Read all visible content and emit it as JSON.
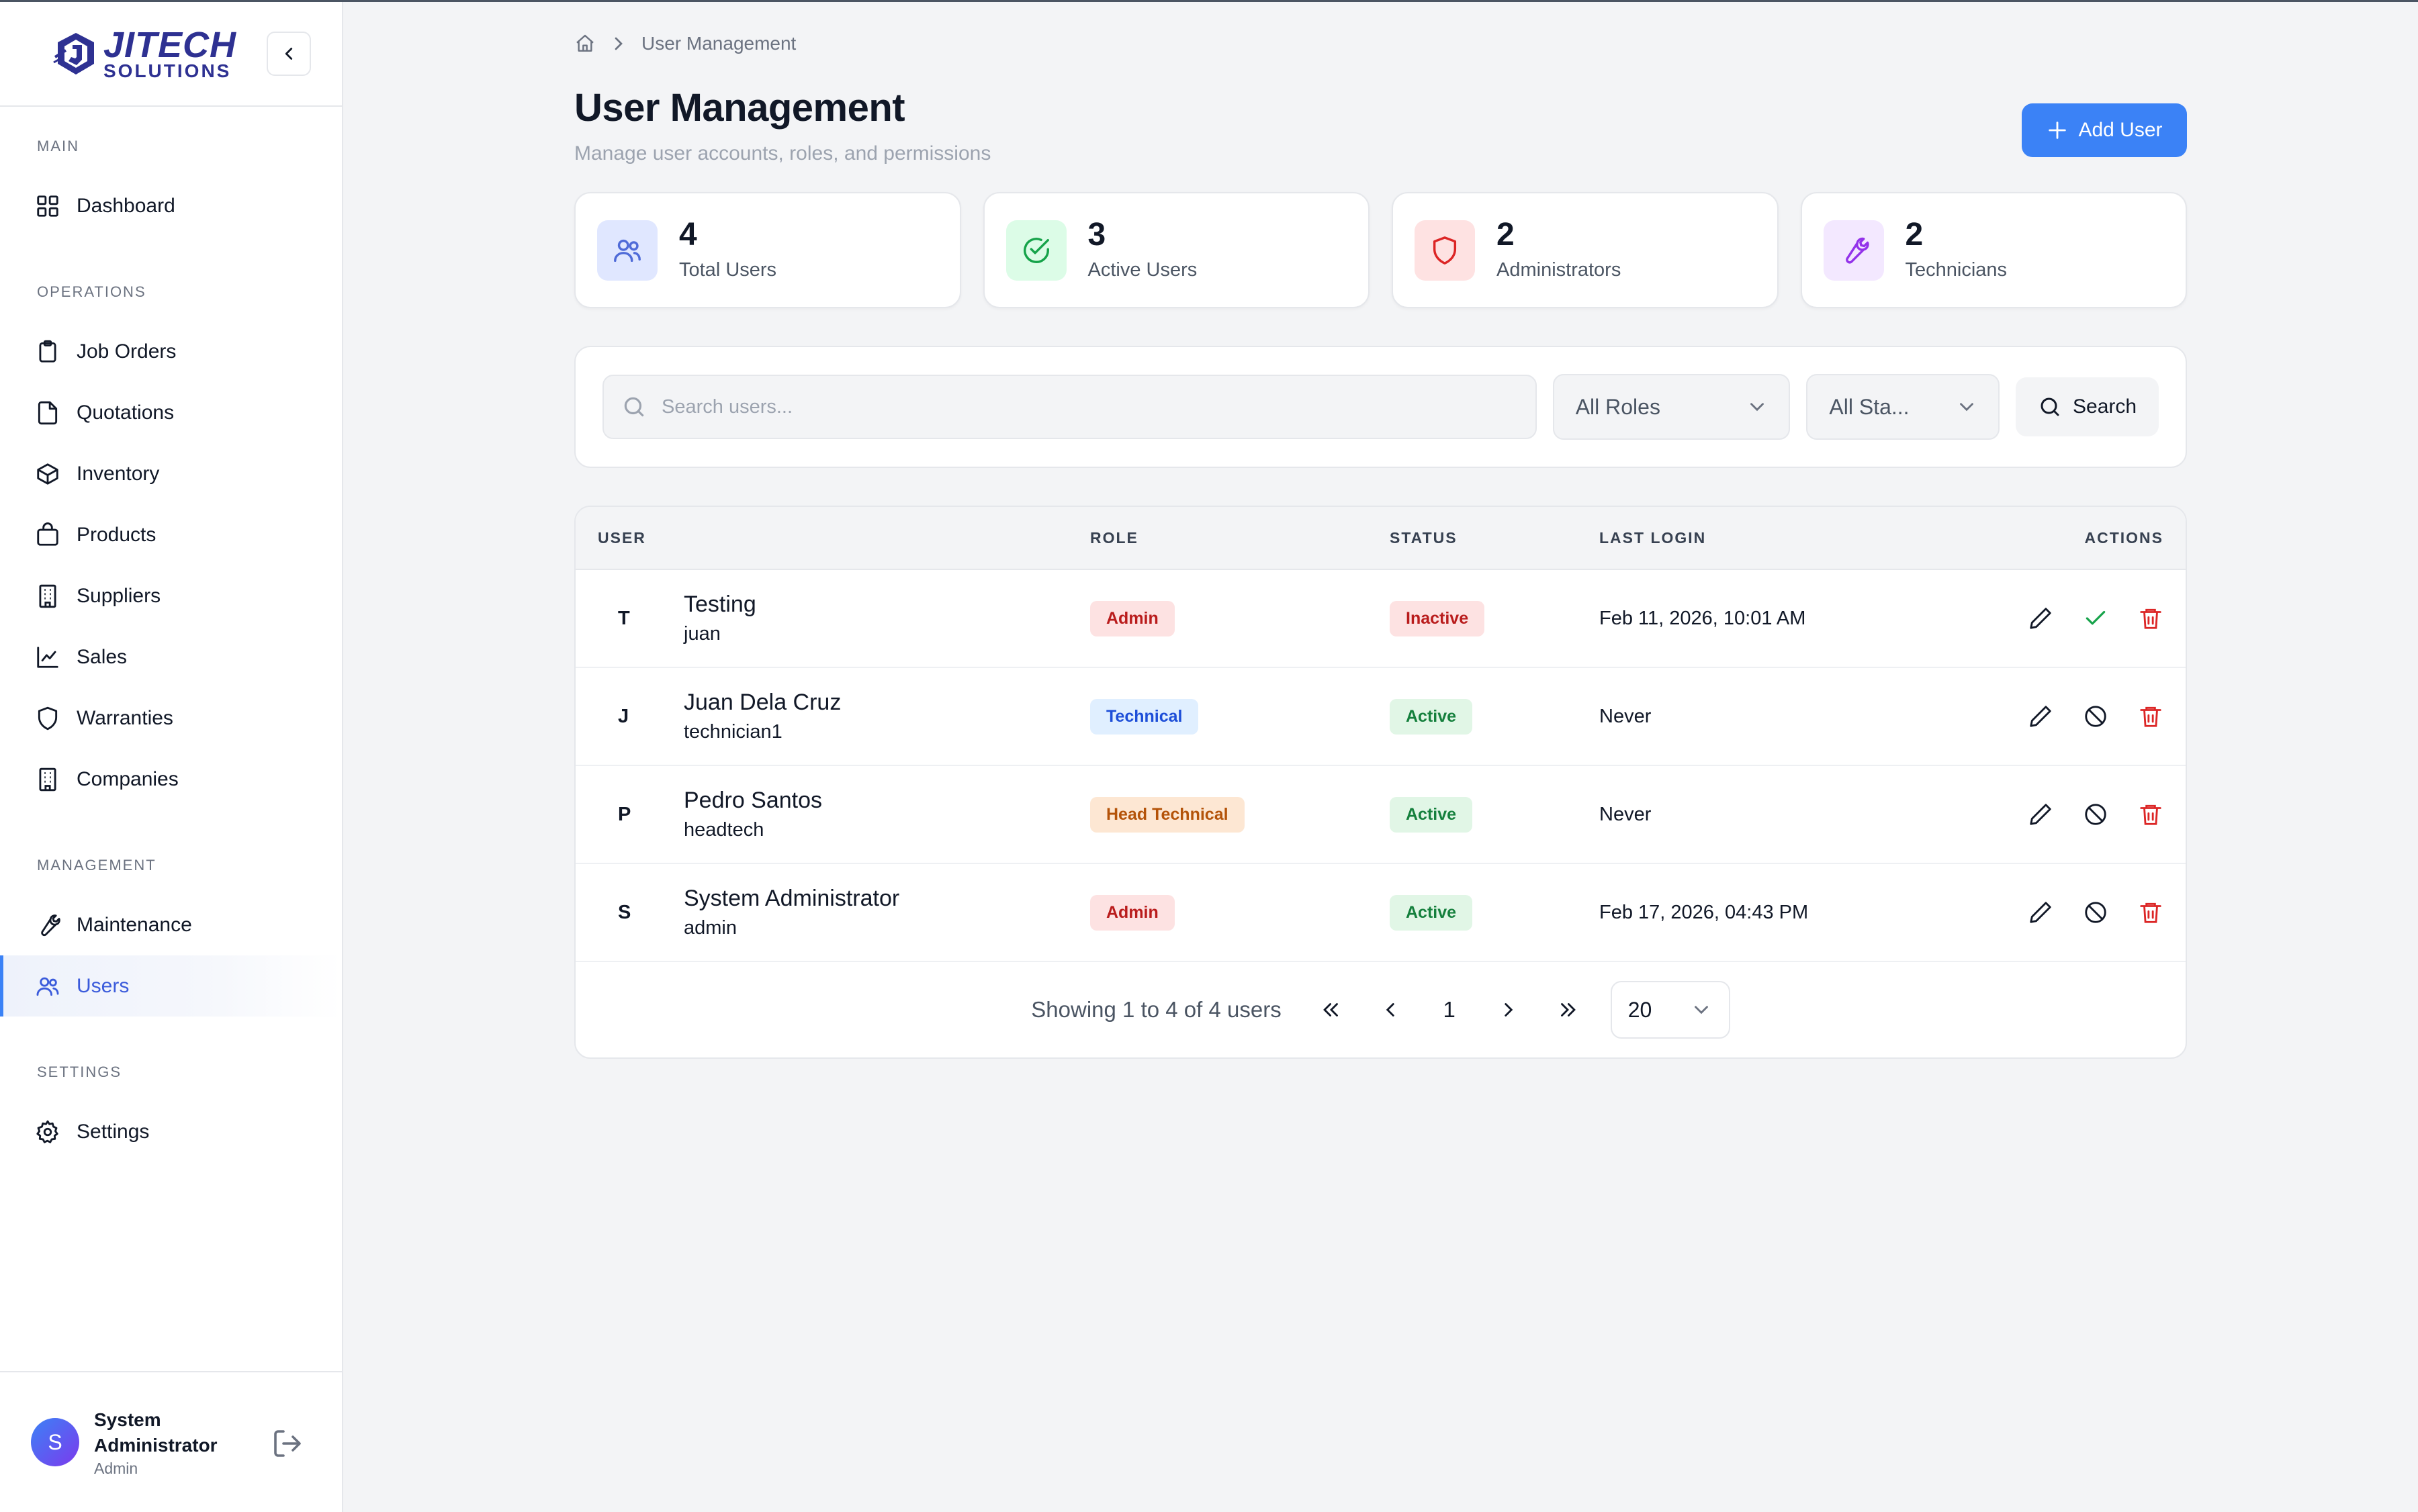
{
  "brand": {
    "logo_top": "JITECH",
    "logo_bottom": "SOLUTIONS"
  },
  "sidebar": {
    "sections": [
      {
        "title": "MAIN",
        "items": [
          {
            "label": "Dashboard",
            "icon": "dashboard-grid-icon"
          }
        ]
      },
      {
        "title": "OPERATIONS",
        "items": [
          {
            "label": "Job Orders",
            "icon": "clipboard-icon"
          },
          {
            "label": "Quotations",
            "icon": "file-icon"
          },
          {
            "label": "Inventory",
            "icon": "box-icon"
          },
          {
            "label": "Products",
            "icon": "shopping-bag-icon"
          },
          {
            "label": "Suppliers",
            "icon": "building-icon"
          },
          {
            "label": "Sales",
            "icon": "trend-chart-icon"
          },
          {
            "label": "Warranties",
            "icon": "shield-icon"
          },
          {
            "label": "Companies",
            "icon": "building-icon"
          }
        ]
      },
      {
        "title": "MANAGEMENT",
        "items": [
          {
            "label": "Maintenance",
            "icon": "wrench-icon"
          },
          {
            "label": "Users",
            "icon": "users-icon",
            "active": true
          }
        ]
      },
      {
        "title": "SETTINGS",
        "items": [
          {
            "label": "Settings",
            "icon": "gear-icon"
          }
        ]
      }
    ],
    "user": {
      "initial": "S",
      "name": "System Administrator",
      "role": "Admin"
    }
  },
  "breadcrumb": {
    "current": "User Management"
  },
  "header": {
    "title": "User Management",
    "subtitle": "Manage user accounts, roles, and permissions",
    "add_label": "Add User"
  },
  "stats": [
    {
      "value": "4",
      "label": "Total Users",
      "icon": "users-icon",
      "bg": "#e0e7ff",
      "color": "#4f6bd8"
    },
    {
      "value": "3",
      "label": "Active Users",
      "icon": "check-circle-icon",
      "bg": "#dcfce7",
      "color": "#16a34a"
    },
    {
      "value": "2",
      "label": "Administrators",
      "icon": "shield-icon",
      "bg": "#fee2e2",
      "color": "#dc2626"
    },
    {
      "value": "2",
      "label": "Technicians",
      "icon": "wrench-icon",
      "bg": "#f3e8ff",
      "color": "#9333ea"
    }
  ],
  "filters": {
    "search_placeholder": "Search users...",
    "role_select": "All Roles",
    "status_select": "All Sta...",
    "search_label": "Search"
  },
  "table": {
    "headers": {
      "user": "USER",
      "role": "ROLE",
      "status": "STATUS",
      "last_login": "LAST LOGIN",
      "actions": "ACTIONS"
    },
    "rows": [
      {
        "initial": "T",
        "name": "Testing",
        "username": "juan",
        "role": "Admin",
        "role_type": "admin",
        "status": "Inactive",
        "status_type": "inactive",
        "last_login": "Feb 11, 2026, 10:01 AM",
        "toggle_icon": "check-icon"
      },
      {
        "initial": "J",
        "name": "Juan Dela Cruz",
        "username": "technician1",
        "role": "Technical",
        "role_type": "tech",
        "status": "Active",
        "status_type": "active",
        "last_login": "Never",
        "toggle_icon": "ban-icon"
      },
      {
        "initial": "P",
        "name": "Pedro Santos",
        "username": "headtech",
        "role": "Head Technical",
        "role_type": "head",
        "status": "Active",
        "status_type": "active",
        "last_login": "Never",
        "toggle_icon": "ban-icon"
      },
      {
        "initial": "S",
        "name": "System Administrator",
        "username": "admin",
        "role": "Admin",
        "role_type": "admin",
        "status": "Active",
        "status_type": "active",
        "last_login": "Feb 17, 2026, 04:43 PM",
        "toggle_icon": "ban-icon"
      }
    ]
  },
  "pagination": {
    "summary": "Showing 1 to 4 of 4 users",
    "page": "1",
    "page_size": "20"
  }
}
